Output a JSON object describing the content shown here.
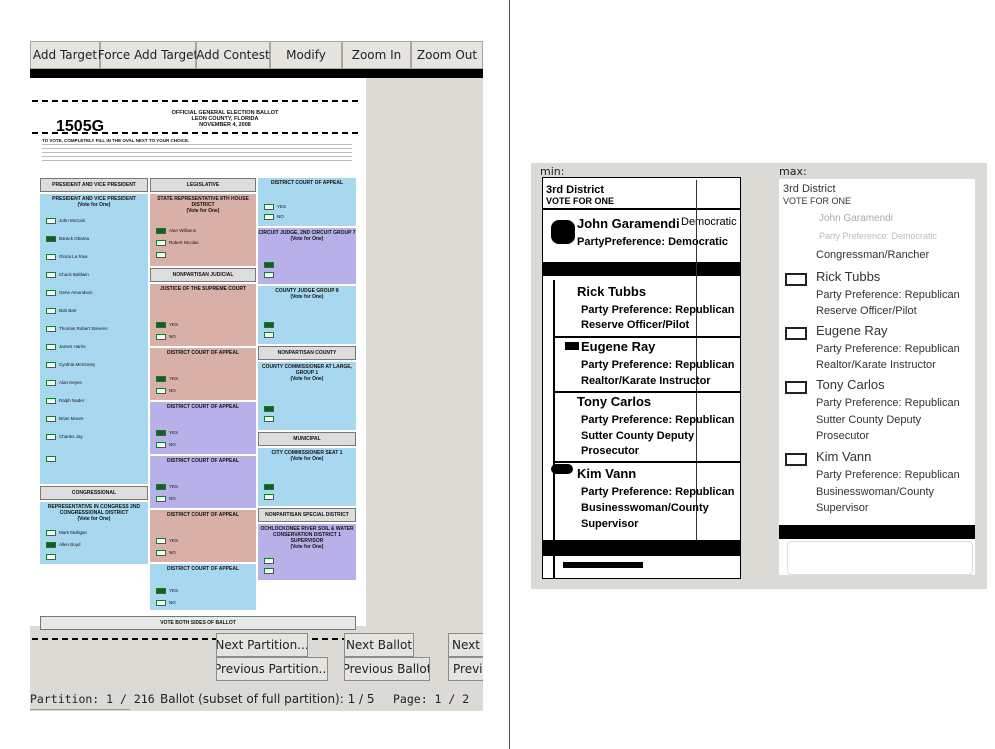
{
  "toolbar": {
    "add_target": "Add Target",
    "force_add_target": "Force Add Target",
    "add_contest": "Add Contest",
    "modify": "Modify",
    "zoom_in": "Zoom In",
    "zoom_out": "Zoom Out"
  },
  "ballot": {
    "id": "1505G",
    "header_line1": "OFFICIAL GENERAL ELECTION BALLOT",
    "header_line2": "LEON COUNTY, FLORIDA",
    "header_line3": "NOVEMBER 4, 2008",
    "instruction": "TO VOTE, COMPLETELY FILL IN THE OVAL NEXT TO YOUR CHOICE.",
    "footer": "VOTE BOTH SIDES OF BALLOT",
    "col1_header": "PRESIDENT AND VICE PRESIDENT",
    "col1_sub": "PRESIDENT AND VICE PRESIDENT",
    "col1_vote": "(Vote for One)",
    "col1_candidates": [
      "John McCain",
      "Barack Obama",
      "Gloria La Riva",
      "Chuck Baldwin",
      "Gene Amondson",
      "Bob Barr",
      "Thomas Robert Stevens",
      "James Harris",
      "Cynthia McKinney",
      "Alan Keyes",
      "Ralph Nader",
      "Brian Moore",
      "Charles Jay"
    ],
    "congressional": "CONGRESSIONAL",
    "rep_congress": "REPRESENTATIVE IN CONGRESS 2ND CONGRESSIONAL DISTRICT",
    "rep_vote": "(Vote for One)",
    "rep_candidates": [
      "Mark Mulligan",
      "Allen Boyd"
    ],
    "col2_header": "LEGISLATIVE",
    "state_rep": "STATE REPRESENTATIVE 8TH HOUSE DISTRICT",
    "state_vote": "(Vote for One)",
    "state_candidates": [
      "Alan Williams",
      "Robert Nicolas"
    ],
    "nonpartisan_judicial": "NONPARTISAN JUDICIAL",
    "justice": "JUSTICE OF THE SUPREME COURT",
    "dca1": "DISTRICT COURT OF APPEAL",
    "dca2": "DISTRICT COURT OF APPEAL",
    "dca3": "DISTRICT COURT OF APPEAL",
    "dca4": "DISTRICT COURT OF APPEAL",
    "dca5": "DISTRICT COURT OF APPEAL",
    "yes": "YES",
    "no": "NO",
    "col3_header": "DISTRICT COURT OF APPEAL",
    "circuit_judge": "CIRCUIT JUDGE, 2ND CIRCUIT GROUP 7",
    "county_judge": "COUNTY JUDGE GROUP 8",
    "nonpartisan_county": "NONPARTISAN COUNTY",
    "county_commissioner": "COUNTY COMMISSIONER AT LARGE, GROUP 1",
    "municipal": "MUNICIPAL",
    "city_commissioner": "CITY COMMISSIONER SEAT 1",
    "special_district": "NONPARTISAN SPECIAL DISTRICT",
    "soil_water": "OCHLOCKONEE RIVER SOIL & WATER CONSERVATION DISTRICT 1 SUPERVISOR",
    "col3_vote": "(Vote for One)"
  },
  "nav": {
    "next_partition": "Next Partition...",
    "next_ballot": "Next Ballot",
    "next": "Next",
    "previous_partition": "Previous Partition...",
    "previous_ballot": "Previous Ballot",
    "previous": "Previo"
  },
  "status": {
    "partition": "Partition: 1 / 216",
    "ballot": "Ballot (subset of full partition): 1 / 5",
    "page": "Page: 1 / 2"
  },
  "compare": {
    "min_label": "min:",
    "max_label": "max:",
    "district": "3rd District",
    "vote_for_one": "VOTE FOR ONE",
    "min_overlap1": "John Garamendi",
    "min_overlap1b": "Democratic",
    "min_overlap2": "PartyPreference: Democratic",
    "max_faint1": "John Garamendi",
    "max_faint2": "Party Preference: Democratic",
    "max_occupation0": "Congressman/Rancher",
    "candidates": [
      {
        "name": "Rick Tubbs",
        "party": "Party Preference: Republican",
        "occ1": "Reserve Officer/Pilot",
        "occ2": ""
      },
      {
        "name": "Eugene Ray",
        "party": "Party Preference: Republican",
        "occ1": "Realtor/Karate Instructor",
        "occ2": ""
      },
      {
        "name": "Tony Carlos",
        "party": "Party Preference: Republican",
        "occ1": "Sutter County Deputy",
        "occ2": "Prosecutor"
      },
      {
        "name": "Kim Vann",
        "party": "Party Preference: Republican",
        "occ1": "Businesswoman/County",
        "occ2": "Supervisor"
      }
    ]
  }
}
